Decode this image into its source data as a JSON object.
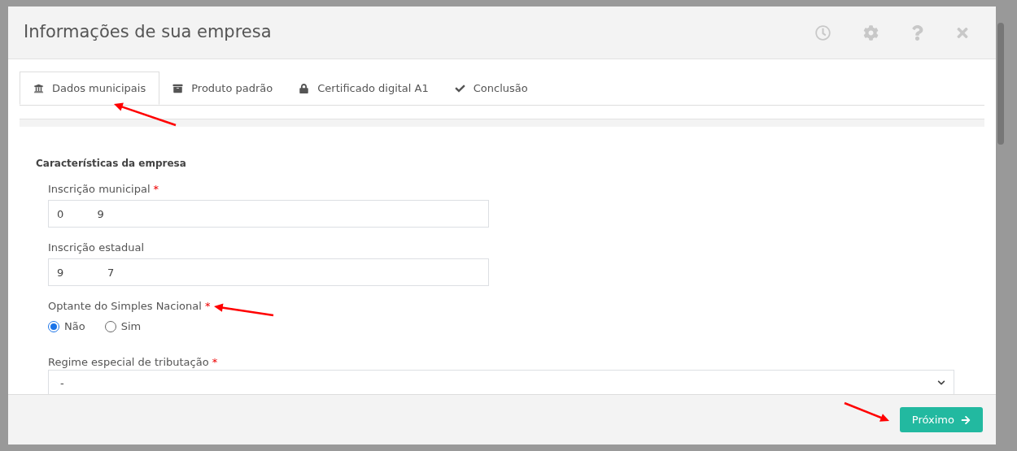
{
  "modal": {
    "title": "Informações de sua empresa"
  },
  "tabs": [
    {
      "label": "Dados municipais",
      "selected": true
    },
    {
      "label": "Produto padrão",
      "selected": false
    },
    {
      "label": "Certificado digital A1",
      "selected": false
    },
    {
      "label": "Conclusão",
      "selected": false
    }
  ],
  "section": {
    "title": "Características da empresa"
  },
  "fields": [
    {
      "kind": "text",
      "label": "Inscrição municipal",
      "marker": "*",
      "value": "0          9"
    },
    {
      "kind": "text",
      "label": "Inscrição estadual",
      "value": "9             7"
    },
    {
      "kind": "radio",
      "label": "Optante do Simples Nacional",
      "marker": "*",
      "options": [
        {
          "label": "Não",
          "selected": true
        },
        {
          "label": "Sim",
          "selected": false
        }
      ]
    },
    {
      "kind": "select",
      "label": "Regime especial de tributação",
      "marker": "*",
      "value": "-"
    }
  ],
  "footer": {
    "button": "Próximo"
  }
}
